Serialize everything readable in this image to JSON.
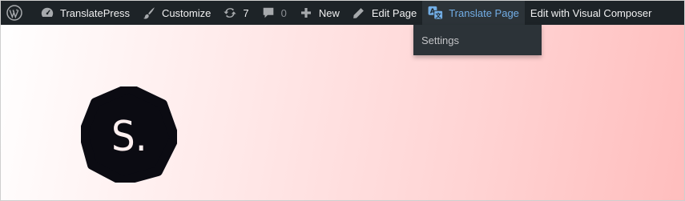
{
  "adminbar": {
    "site_name": "TranslatePress",
    "customize": "Customize",
    "updates_count": "7",
    "comments_count": "0",
    "new": "New",
    "edit_page": "Edit Page",
    "translate_page": "Translate Page",
    "edit_visual_composer": "Edit with Visual Composer"
  },
  "dropdown": {
    "settings": "Settings"
  },
  "logo": {
    "letter": "S."
  },
  "colors": {
    "adminbar_bg": "#1d2327",
    "active_link": "#72aee6",
    "logo_bg": "#0b0b12"
  }
}
